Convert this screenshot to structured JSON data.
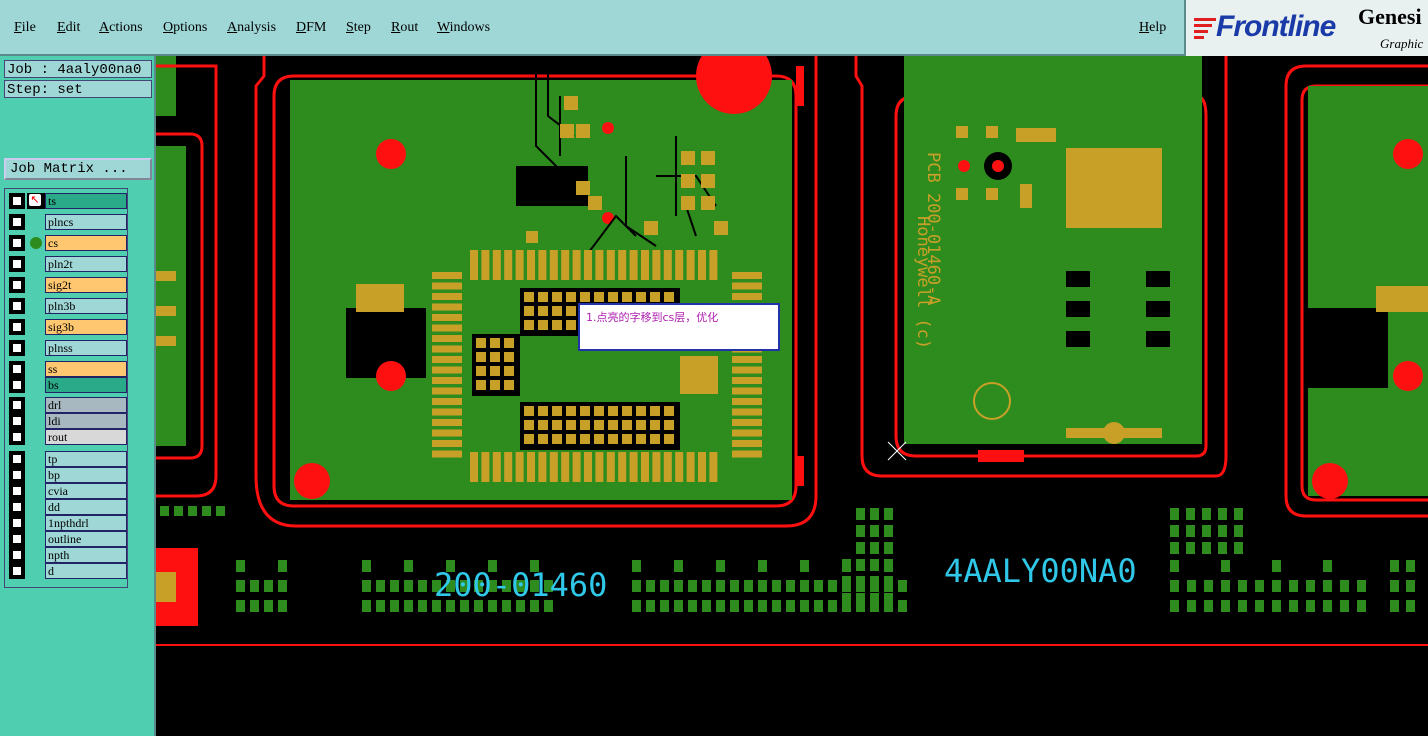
{
  "menu": {
    "items": [
      "File",
      "Edit",
      "Actions",
      "Options",
      "Analysis",
      "DFM",
      "Step",
      "Rout",
      "Windows"
    ],
    "help": "Help"
  },
  "logo": {
    "brand": "Frontline",
    "product": "Genesi",
    "sub": "Graphic"
  },
  "job": {
    "label": "Job : 4aaly00na0",
    "step": "Step: set",
    "matrix_button": "Job Matrix ..."
  },
  "layers": [
    {
      "name": "ts",
      "color": "#2aaa88"
    },
    {
      "name": "plncs",
      "color": "#9fd6d6"
    },
    {
      "name": "cs",
      "color": "#ffc870"
    },
    {
      "name": "pln2t",
      "color": "#9fd6d6"
    },
    {
      "name": "sig2t",
      "color": "#ffc870"
    },
    {
      "name": "pln3b",
      "color": "#9fd6d6"
    },
    {
      "name": "sig3b",
      "color": "#ffc870"
    },
    {
      "name": "plnss",
      "color": "#9fd6d6"
    },
    {
      "name": "ss",
      "color": "#ffc870"
    },
    {
      "name": "bs",
      "color": "#2aaa88"
    },
    {
      "name": "drl",
      "color": "#a8b8c0"
    },
    {
      "name": "ldi",
      "color": "#a8b8c0"
    },
    {
      "name": "rout",
      "color": "#d8d8d8"
    },
    {
      "name": "tp",
      "color": "#9fd6d6"
    },
    {
      "name": "bp",
      "color": "#9fd6d6"
    },
    {
      "name": "cvia",
      "color": "#9fd6d6"
    },
    {
      "name": "dd",
      "color": "#9fd6d6"
    },
    {
      "name": "1npthdrl",
      "color": "#9fd6d6"
    },
    {
      "name": "outline",
      "color": "#9fd6d6"
    },
    {
      "name": "npth",
      "color": "#9fd6d6"
    },
    {
      "name": "d",
      "color": "#9fd6d6"
    }
  ],
  "board": {
    "part_number": "200-01460",
    "job_code": "4AALY00NA0",
    "silk_line1": "PCB 200-01460-A",
    "silk_line2": "Honeywell (c)"
  },
  "annotation": "1.点亮的字移到cs层，优化",
  "colors": {
    "copper": "#2e8b1e",
    "pad": "#c8a028",
    "outline": "#ff1010",
    "text": "#30c8e8"
  }
}
